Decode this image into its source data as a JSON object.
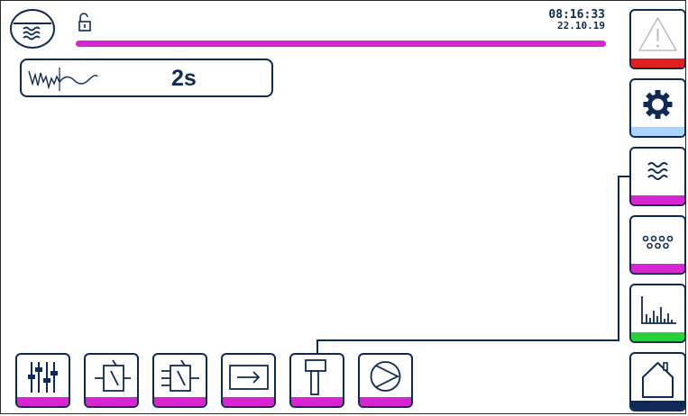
{
  "header": {
    "time": "08:16:33",
    "date": "22.10.19",
    "progress": 1.0
  },
  "signal_panel": {
    "value": "2s"
  },
  "colors": {
    "accent_magenta": "#d925d0",
    "alarm_red": "#e02020",
    "settings_blue": "#a9d4ff",
    "chart_green": "#27d13c",
    "home_navy": "#0d2a57",
    "outline": "#0d2a57"
  },
  "right_menu": [
    {
      "icon": "warning-icon",
      "stripe": "alarm_red"
    },
    {
      "icon": "gear-icon",
      "stripe": "settings_blue"
    },
    {
      "icon": "waves-icon",
      "stripe": "accent_magenta"
    },
    {
      "icon": "dots-icon",
      "stripe": "accent_magenta"
    },
    {
      "icon": "bar-chart-icon",
      "stripe": "chart_green"
    },
    {
      "icon": "home-icon",
      "stripe": "home_navy"
    }
  ],
  "bottom_menu": [
    {
      "icon": "sliders-icon"
    },
    {
      "icon": "module-in-icon"
    },
    {
      "icon": "module-out-icon"
    },
    {
      "icon": "arrow-right-icon"
    },
    {
      "icon": "probe-icon"
    },
    {
      "icon": "pump-icon"
    }
  ]
}
